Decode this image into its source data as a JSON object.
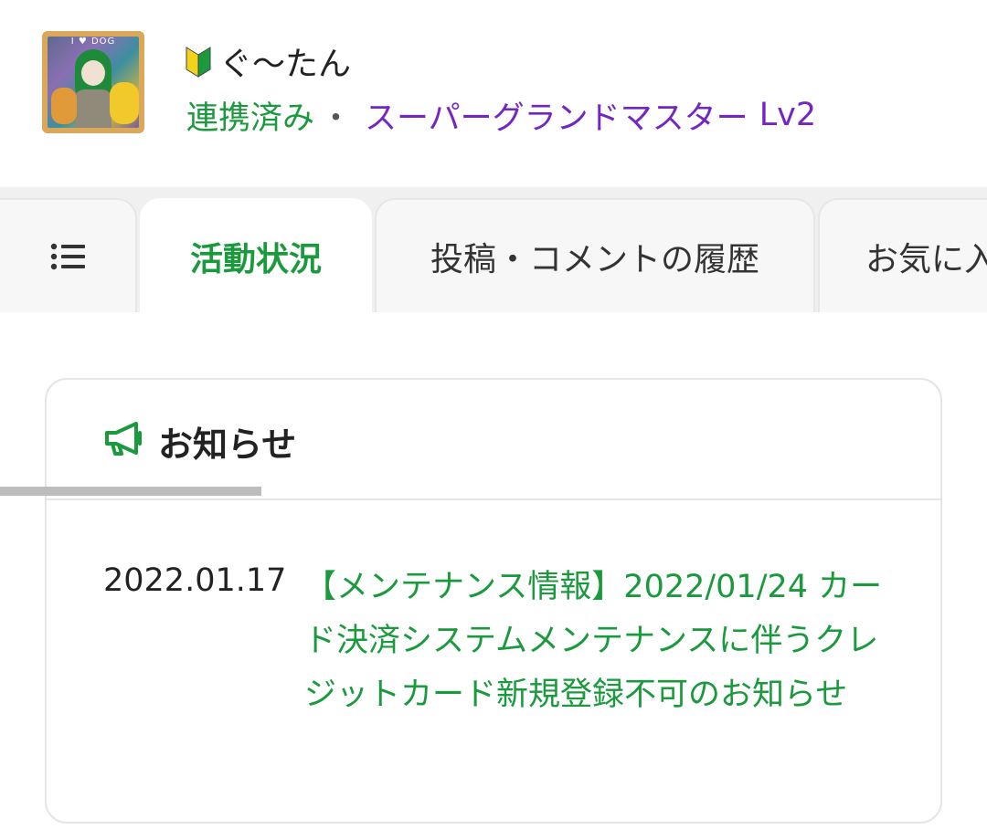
{
  "profile": {
    "avatar_caption": "I ♥ DOG",
    "username": "ぐ〜たん",
    "linked_label": "連携済み",
    "separator": "・",
    "rank": "スーパーグランドマスター",
    "level": "Lv2"
  },
  "tabs": {
    "active": "活動状況",
    "posts": "投稿・コメントの履歴",
    "favorites": "お気に入"
  },
  "notice": {
    "title": "お知らせ",
    "items": [
      {
        "date": "2022.01.17",
        "text": "【メンテナンス情報】2022/01/24 カード決済システムメンテナンスに伴うクレジットカード新規登録不可のお知らせ"
      }
    ]
  },
  "colors": {
    "green": "#1a9a3c",
    "purple": "#7326c4"
  }
}
